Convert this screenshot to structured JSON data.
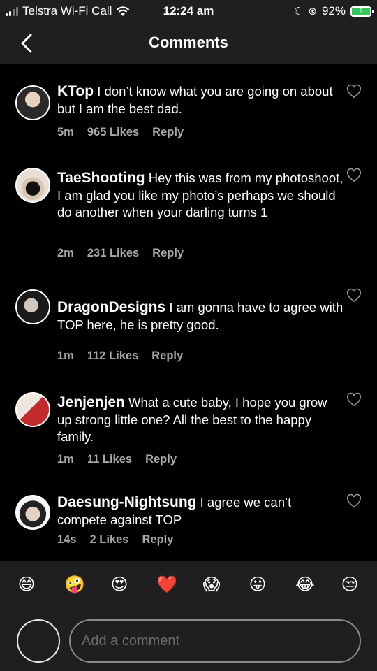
{
  "status_bar": {
    "carrier": "Telstra Wi-Fi Call",
    "time": "12:24 am",
    "battery": "92%"
  },
  "header": {
    "title": "Comments",
    "back_icon": "chevron-left-icon"
  },
  "comments": [
    {
      "username": "KTop",
      "text": "I don’t know what you are going on about but I am the best dad.",
      "time": "5m",
      "likes": "965 Likes",
      "reply": "Reply"
    },
    {
      "username": "TaeShooting",
      "text": "Hey this was from my photoshoot, I am glad you like my photo’s perhaps we should do another when your darling turns 1",
      "time": "2m",
      "likes": "231 Likes",
      "reply": "Reply"
    },
    {
      "username": "DragonDesigns",
      "text": "I am gonna have to agree with TOP here, he is pretty good.",
      "time": "1m",
      "likes": "112 Likes",
      "reply": "Reply"
    },
    {
      "username": "Jenjenjen",
      "text": "What a cute baby, I hope you grow up strong little one? All the best to the happy family.",
      "time": "1m",
      "likes": "11 Likes",
      "reply": "Reply"
    },
    {
      "username": "Daesung-Nightsung",
      "text": "I agree we can’t compete against TOP",
      "time": "14s",
      "likes": "2 Likes",
      "reply": "Reply"
    }
  ],
  "emoji_bar": [
    "😄",
    "🤪",
    "😍",
    "❤️",
    "😱",
    "😛",
    "😂",
    "😒"
  ],
  "composer": {
    "placeholder": "Add a comment"
  },
  "colors": {
    "background": "#000000",
    "bar_background": "#1f1f21",
    "meta_text": "#a8a8a8",
    "battery_green": "#34c759"
  }
}
